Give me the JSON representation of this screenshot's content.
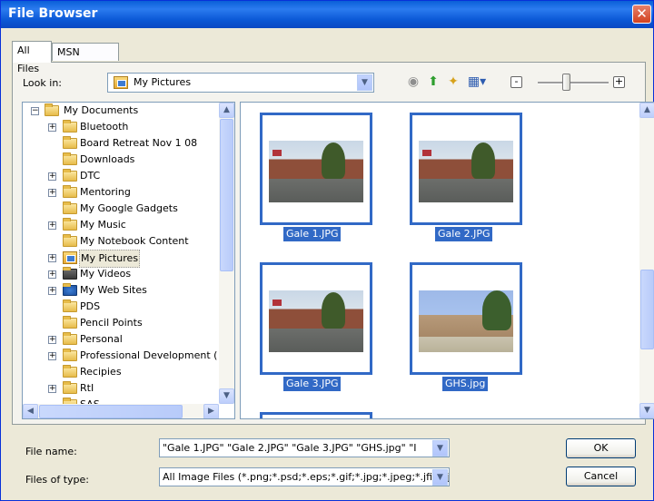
{
  "window": {
    "title": "File Browser",
    "close_glyph": "✕"
  },
  "tabs": [
    {
      "label": "All Files",
      "active": true
    },
    {
      "label": "MSN Groups",
      "active": false
    }
  ],
  "lookin": {
    "label": "Look in:",
    "value": "My Pictures"
  },
  "toolbar_icons": [
    "back-icon",
    "up-folder-icon",
    "new-folder-icon",
    "views-menu-icon"
  ],
  "zoom": {
    "minus": "-",
    "plus": "+",
    "level": 0.4
  },
  "tree": {
    "root": "My Documents",
    "items": [
      {
        "label": "Bluetooth",
        "expandable": true
      },
      {
        "label": "Board Retreat Nov 1 08",
        "expandable": false
      },
      {
        "label": "Downloads",
        "expandable": false
      },
      {
        "label": "DTC",
        "expandable": true
      },
      {
        "label": "Mentoring",
        "expandable": true
      },
      {
        "label": "My Google Gadgets",
        "expandable": false
      },
      {
        "label": "My Music",
        "expandable": true
      },
      {
        "label": "My Notebook Content",
        "expandable": false
      },
      {
        "label": "My Pictures",
        "expandable": true,
        "selected": true
      },
      {
        "label": "My Videos",
        "expandable": true
      },
      {
        "label": "My Web Sites",
        "expandable": true
      },
      {
        "label": "PDS",
        "expandable": false
      },
      {
        "label": "Pencil Points",
        "expandable": false
      },
      {
        "label": "Personal",
        "expandable": true
      },
      {
        "label": "Professional Development (",
        "expandable": true
      },
      {
        "label": "Recipies",
        "expandable": false
      },
      {
        "label": "RtI",
        "expandable": true
      },
      {
        "label": "SAS",
        "expandable": false
      }
    ]
  },
  "files": [
    {
      "name": "Gale 1.JPG",
      "selected": true
    },
    {
      "name": "Gale 2.JPG",
      "selected": true
    },
    {
      "name": "Gale 3.JPG",
      "selected": true
    },
    {
      "name": "GHS.jpg",
      "selected": true
    }
  ],
  "filename": {
    "label": "File name:",
    "value": "\"Gale 1.JPG\" \"Gale 2.JPG\" \"Gale 3.JPG\" \"GHS.jpg\" \"I"
  },
  "filetype": {
    "label": "Files of type:",
    "value": "All Image Files (*.png;*.psd;*.eps;*.gif;*.jpg;*.jpeg;*.jfif;*.j"
  },
  "buttons": {
    "ok": "OK",
    "cancel": "Cancel"
  },
  "colors": {
    "title_blue": "#0A5FD8",
    "selection_blue": "#3169C6",
    "face": "#ECE9D8"
  }
}
